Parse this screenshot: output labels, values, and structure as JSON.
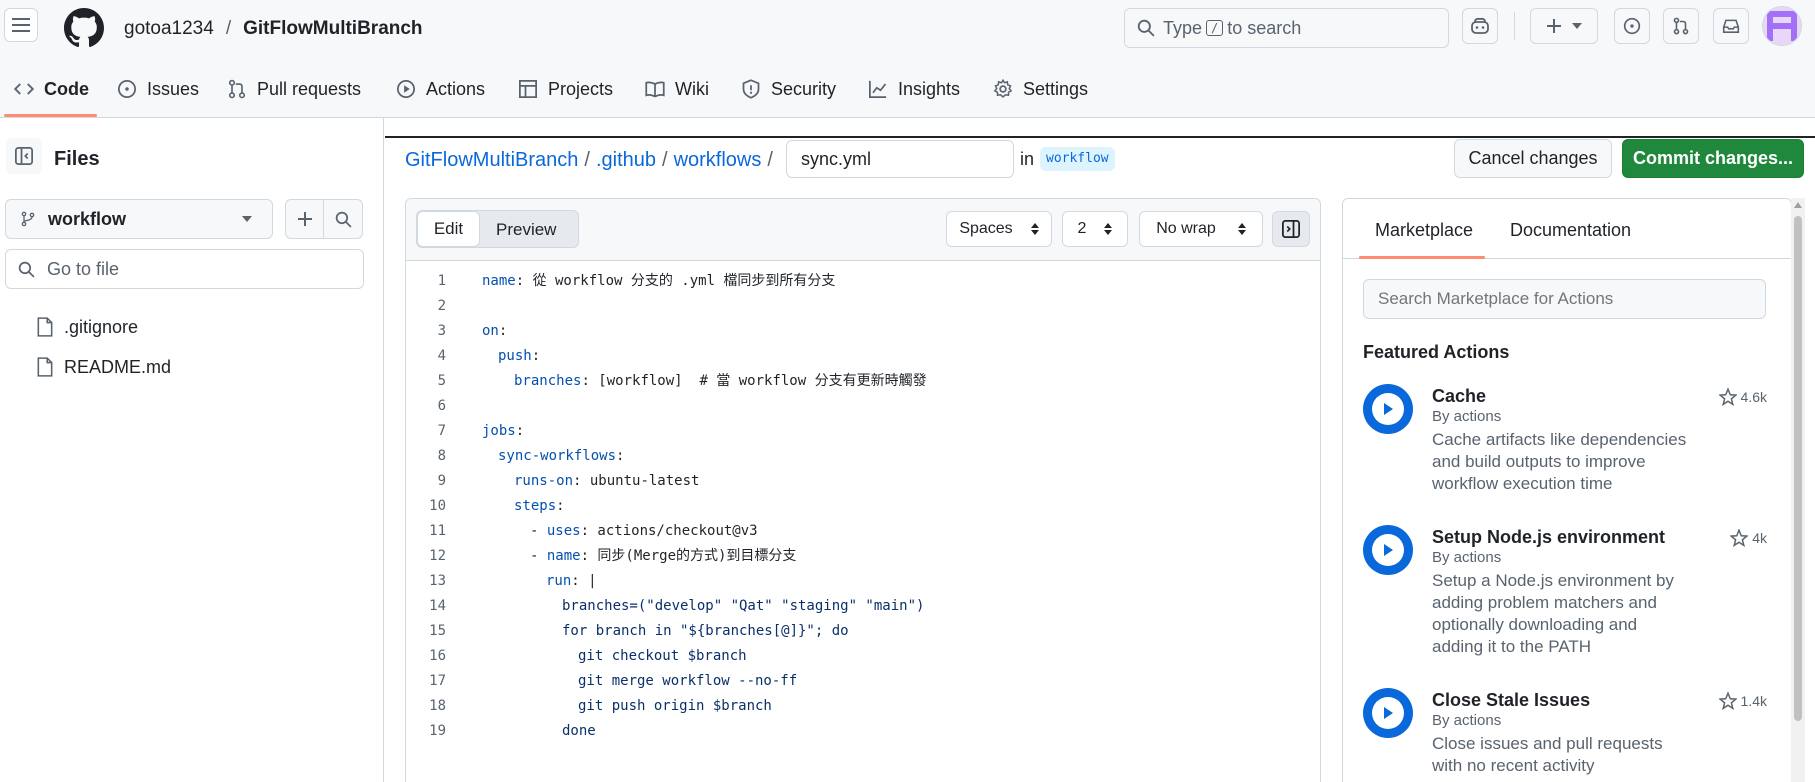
{
  "header": {
    "owner": "gotoa1234",
    "separator": "/",
    "repo": "GitFlowMultiBranch",
    "search": {
      "prefix": "Type",
      "key": "/",
      "suffix": "to search"
    }
  },
  "nav": {
    "code": "Code",
    "issues": "Issues",
    "pulls": "Pull requests",
    "actions": "Actions",
    "projects": "Projects",
    "wiki": "Wiki",
    "security": "Security",
    "insights": "Insights",
    "settings": "Settings"
  },
  "sidebar": {
    "title": "Files",
    "branch": "workflow",
    "goto_placeholder": "Go to file",
    "files": [
      ".gitignore",
      "README.md"
    ]
  },
  "editor": {
    "breadcrumb": {
      "repo": "GitFlowMultiBranch",
      "dir1": ".github",
      "dir2": "workflows",
      "sep": "/"
    },
    "filename": "sync.yml",
    "in_label": "in",
    "branch_badge": "workflow",
    "cancel_label": "Cancel changes",
    "commit_label": "Commit changes...",
    "tabs": {
      "edit": "Edit",
      "preview": "Preview"
    },
    "indent_mode": "Spaces",
    "indent_size": "2",
    "wrap_mode": "No wrap",
    "lines": [
      {
        "n": "1",
        "i": 0,
        "parts": [
          [
            "k",
            "name"
          ],
          [
            "t",
            ": 從 workflow 分支的 .yml 檔同步到所有分支"
          ]
        ]
      },
      {
        "n": "2",
        "i": 0,
        "parts": []
      },
      {
        "n": "3",
        "i": 0,
        "parts": [
          [
            "k",
            "on"
          ],
          [
            "t",
            ":"
          ]
        ]
      },
      {
        "n": "4",
        "i": 1,
        "parts": [
          [
            "k",
            "push"
          ],
          [
            "t",
            ":"
          ]
        ]
      },
      {
        "n": "5",
        "i": 2,
        "parts": [
          [
            "k",
            "branches"
          ],
          [
            "t",
            ": [workflow]  # 當 workflow 分支有更新時觸發"
          ]
        ]
      },
      {
        "n": "6",
        "i": 0,
        "parts": []
      },
      {
        "n": "7",
        "i": 0,
        "parts": [
          [
            "k",
            "jobs"
          ],
          [
            "t",
            ":"
          ]
        ]
      },
      {
        "n": "8",
        "i": 1,
        "parts": [
          [
            "k",
            "sync-workflows"
          ],
          [
            "t",
            ":"
          ]
        ]
      },
      {
        "n": "9",
        "i": 2,
        "parts": [
          [
            "k",
            "runs-on"
          ],
          [
            "t",
            ": ubuntu-latest"
          ]
        ]
      },
      {
        "n": "10",
        "i": 2,
        "parts": [
          [
            "k",
            "steps"
          ],
          [
            "t",
            ":"
          ]
        ]
      },
      {
        "n": "11",
        "i": 3,
        "parts": [
          [
            "t",
            "- "
          ],
          [
            "k",
            "uses"
          ],
          [
            "t",
            ": actions/checkout@v3"
          ]
        ]
      },
      {
        "n": "12",
        "i": 3,
        "parts": [
          [
            "t",
            "- "
          ],
          [
            "k",
            "name"
          ],
          [
            "t",
            ": 同步(Merge的方式)到目標分支"
          ]
        ]
      },
      {
        "n": "13",
        "i": 4,
        "parts": [
          [
            "k",
            "run"
          ],
          [
            "t",
            ": |"
          ]
        ]
      },
      {
        "n": "14",
        "i": 5,
        "parts": [
          [
            "s",
            "branches=(\"develop\" \"Qat\" \"staging\" \"main\")"
          ]
        ]
      },
      {
        "n": "15",
        "i": 5,
        "parts": [
          [
            "s",
            "for branch in \"${branches[@]}\"; do"
          ]
        ]
      },
      {
        "n": "16",
        "i": 6,
        "parts": [
          [
            "s",
            "git checkout $branch"
          ]
        ]
      },
      {
        "n": "17",
        "i": 6,
        "parts": [
          [
            "s",
            "git merge workflow --no-ff"
          ]
        ]
      },
      {
        "n": "18",
        "i": 6,
        "parts": [
          [
            "s",
            "git push origin $branch"
          ]
        ]
      },
      {
        "n": "19",
        "i": 5,
        "parts": [
          [
            "s",
            "done"
          ]
        ]
      }
    ]
  },
  "marketplace": {
    "tab_marketplace": "Marketplace",
    "tab_docs": "Documentation",
    "search_placeholder": "Search Marketplace for Actions",
    "featured_title": "Featured Actions",
    "actions": [
      {
        "title": "Cache",
        "by": "By actions",
        "stars": "4.6k",
        "desc": [
          "Cache artifacts like dependencies",
          "and build outputs to improve",
          "workflow execution time"
        ]
      },
      {
        "title": "Setup Node.js environment",
        "by": "By actions",
        "stars": "4k",
        "desc": [
          "Setup a Node.js environment by",
          "adding problem matchers and",
          "optionally downloading and",
          "adding it to the PATH"
        ]
      },
      {
        "title": "Close Stale Issues",
        "by": "By actions",
        "stars": "1.4k",
        "desc": [
          "Close issues and pull requests",
          "with no recent activity"
        ]
      }
    ]
  },
  "colors": {
    "accent": "#0969da",
    "commit_green": "#1f883d",
    "underline": "#fd8c73"
  }
}
